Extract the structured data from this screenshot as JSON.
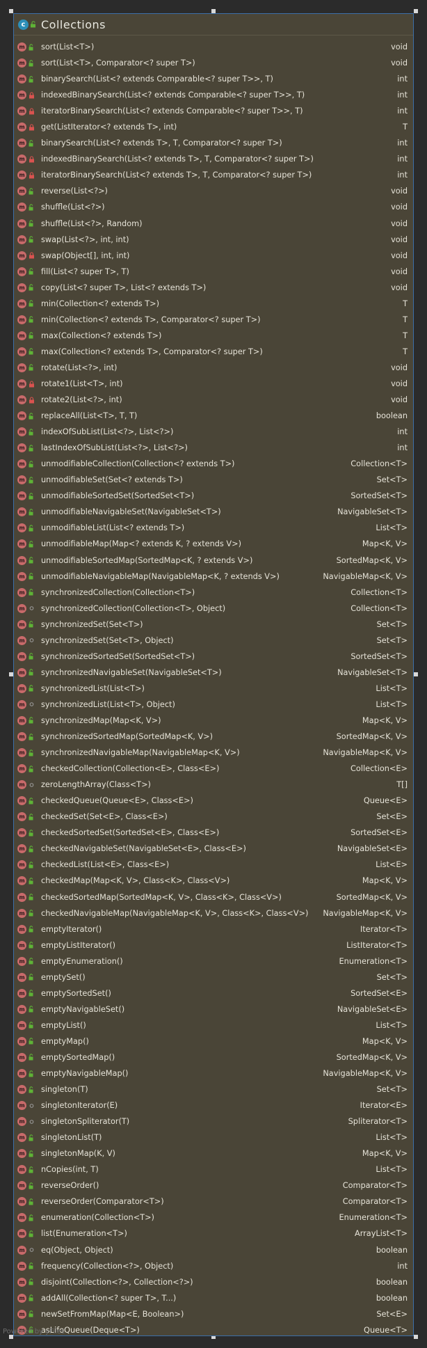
{
  "diagram": {
    "class_name": "Collections",
    "footer": "Powered by yFiles",
    "methods": [
      {
        "signature": "sort(List<T>)",
        "returns": "void",
        "visibility": "public"
      },
      {
        "signature": "sort(List<T>, Comparator<? super T>)",
        "returns": "void",
        "visibility": "public"
      },
      {
        "signature": "binarySearch(List<? extends Comparable<? super T>>, T)",
        "returns": "int",
        "visibility": "public"
      },
      {
        "signature": "indexedBinarySearch(List<? extends Comparable<? super T>>, T)",
        "returns": "int",
        "visibility": "private"
      },
      {
        "signature": "iteratorBinarySearch(List<? extends Comparable<? super T>>, T)",
        "returns": "int",
        "visibility": "private"
      },
      {
        "signature": "get(ListIterator<? extends T>, int)",
        "returns": "T",
        "visibility": "private"
      },
      {
        "signature": "binarySearch(List<? extends T>, T, Comparator<? super T>)",
        "returns": "int",
        "visibility": "public"
      },
      {
        "signature": "indexedBinarySearch(List<? extends T>, T, Comparator<? super T>)",
        "returns": "int",
        "visibility": "private"
      },
      {
        "signature": "iteratorBinarySearch(List<? extends T>, T, Comparator<? super T>)",
        "returns": "int",
        "visibility": "private"
      },
      {
        "signature": "reverse(List<?>)",
        "returns": "void",
        "visibility": "public"
      },
      {
        "signature": "shuffle(List<?>)",
        "returns": "void",
        "visibility": "public"
      },
      {
        "signature": "shuffle(List<?>, Random)",
        "returns": "void",
        "visibility": "public"
      },
      {
        "signature": "swap(List<?>, int, int)",
        "returns": "void",
        "visibility": "public"
      },
      {
        "signature": "swap(Object[], int, int)",
        "returns": "void",
        "visibility": "private"
      },
      {
        "signature": "fill(List<? super T>, T)",
        "returns": "void",
        "visibility": "public"
      },
      {
        "signature": "copy(List<? super T>, List<? extends T>)",
        "returns": "void",
        "visibility": "public"
      },
      {
        "signature": "min(Collection<? extends T>)",
        "returns": "T",
        "visibility": "public"
      },
      {
        "signature": "min(Collection<? extends T>, Comparator<? super T>)",
        "returns": "T",
        "visibility": "public"
      },
      {
        "signature": "max(Collection<? extends T>)",
        "returns": "T",
        "visibility": "public"
      },
      {
        "signature": "max(Collection<? extends T>, Comparator<? super T>)",
        "returns": "T",
        "visibility": "public"
      },
      {
        "signature": "rotate(List<?>, int)",
        "returns": "void",
        "visibility": "public"
      },
      {
        "signature": "rotate1(List<T>, int)",
        "returns": "void",
        "visibility": "private"
      },
      {
        "signature": "rotate2(List<?>, int)",
        "returns": "void",
        "visibility": "private"
      },
      {
        "signature": "replaceAll(List<T>, T, T)",
        "returns": "boolean",
        "visibility": "public"
      },
      {
        "signature": "indexOfSubList(List<?>, List<?>)",
        "returns": "int",
        "visibility": "public"
      },
      {
        "signature": "lastIndexOfSubList(List<?>, List<?>)",
        "returns": "int",
        "visibility": "public"
      },
      {
        "signature": "unmodifiableCollection(Collection<? extends T>)",
        "returns": "Collection<T>",
        "visibility": "public"
      },
      {
        "signature": "unmodifiableSet(Set<? extends T>)",
        "returns": "Set<T>",
        "visibility": "public"
      },
      {
        "signature": "unmodifiableSortedSet(SortedSet<T>)",
        "returns": "SortedSet<T>",
        "visibility": "public"
      },
      {
        "signature": "unmodifiableNavigableSet(NavigableSet<T>)",
        "returns": "NavigableSet<T>",
        "visibility": "public"
      },
      {
        "signature": "unmodifiableList(List<? extends T>)",
        "returns": "List<T>",
        "visibility": "public"
      },
      {
        "signature": "unmodifiableMap(Map<? extends K, ? extends V>)",
        "returns": "Map<K, V>",
        "visibility": "public"
      },
      {
        "signature": "unmodifiableSortedMap(SortedMap<K, ? extends V>)",
        "returns": "SortedMap<K, V>",
        "visibility": "public"
      },
      {
        "signature": "unmodifiableNavigableMap(NavigableMap<K, ? extends V>)",
        "returns": "NavigableMap<K, V>",
        "visibility": "public"
      },
      {
        "signature": "synchronizedCollection(Collection<T>)",
        "returns": "Collection<T>",
        "visibility": "public"
      },
      {
        "signature": "synchronizedCollection(Collection<T>, Object)",
        "returns": "Collection<T>",
        "visibility": "package"
      },
      {
        "signature": "synchronizedSet(Set<T>)",
        "returns": "Set<T>",
        "visibility": "public"
      },
      {
        "signature": "synchronizedSet(Set<T>, Object)",
        "returns": "Set<T>",
        "visibility": "package"
      },
      {
        "signature": "synchronizedSortedSet(SortedSet<T>)",
        "returns": "SortedSet<T>",
        "visibility": "public"
      },
      {
        "signature": "synchronizedNavigableSet(NavigableSet<T>)",
        "returns": "NavigableSet<T>",
        "visibility": "public"
      },
      {
        "signature": "synchronizedList(List<T>)",
        "returns": "List<T>",
        "visibility": "public"
      },
      {
        "signature": "synchronizedList(List<T>, Object)",
        "returns": "List<T>",
        "visibility": "package"
      },
      {
        "signature": "synchronizedMap(Map<K, V>)",
        "returns": "Map<K, V>",
        "visibility": "public"
      },
      {
        "signature": "synchronizedSortedMap(SortedMap<K, V>)",
        "returns": "SortedMap<K, V>",
        "visibility": "public"
      },
      {
        "signature": "synchronizedNavigableMap(NavigableMap<K, V>)",
        "returns": "NavigableMap<K, V>",
        "visibility": "public"
      },
      {
        "signature": "checkedCollection(Collection<E>, Class<E>)",
        "returns": "Collection<E>",
        "visibility": "public"
      },
      {
        "signature": "zeroLengthArray(Class<T>)",
        "returns": "T[]",
        "visibility": "package"
      },
      {
        "signature": "checkedQueue(Queue<E>, Class<E>)",
        "returns": "Queue<E>",
        "visibility": "public"
      },
      {
        "signature": "checkedSet(Set<E>, Class<E>)",
        "returns": "Set<E>",
        "visibility": "public"
      },
      {
        "signature": "checkedSortedSet(SortedSet<E>, Class<E>)",
        "returns": "SortedSet<E>",
        "visibility": "public"
      },
      {
        "signature": "checkedNavigableSet(NavigableSet<E>, Class<E>)",
        "returns": "NavigableSet<E>",
        "visibility": "public"
      },
      {
        "signature": "checkedList(List<E>, Class<E>)",
        "returns": "List<E>",
        "visibility": "public"
      },
      {
        "signature": "checkedMap(Map<K, V>, Class<K>, Class<V>)",
        "returns": "Map<K, V>",
        "visibility": "public"
      },
      {
        "signature": "checkedSortedMap(SortedMap<K, V>, Class<K>, Class<V>)",
        "returns": "SortedMap<K, V>",
        "visibility": "public"
      },
      {
        "signature": "checkedNavigableMap(NavigableMap<K, V>, Class<K>, Class<V>)",
        "returns": "NavigableMap<K, V>",
        "visibility": "public"
      },
      {
        "signature": "emptyIterator()",
        "returns": "Iterator<T>",
        "visibility": "public"
      },
      {
        "signature": "emptyListIterator()",
        "returns": "ListIterator<T>",
        "visibility": "public"
      },
      {
        "signature": "emptyEnumeration()",
        "returns": "Enumeration<T>",
        "visibility": "public"
      },
      {
        "signature": "emptySet()",
        "returns": "Set<T>",
        "visibility": "public"
      },
      {
        "signature": "emptySortedSet()",
        "returns": "SortedSet<E>",
        "visibility": "public"
      },
      {
        "signature": "emptyNavigableSet()",
        "returns": "NavigableSet<E>",
        "visibility": "public"
      },
      {
        "signature": "emptyList()",
        "returns": "List<T>",
        "visibility": "public"
      },
      {
        "signature": "emptyMap()",
        "returns": "Map<K, V>",
        "visibility": "public"
      },
      {
        "signature": "emptySortedMap()",
        "returns": "SortedMap<K, V>",
        "visibility": "public"
      },
      {
        "signature": "emptyNavigableMap()",
        "returns": "NavigableMap<K, V>",
        "visibility": "public"
      },
      {
        "signature": "singleton(T)",
        "returns": "Set<T>",
        "visibility": "public"
      },
      {
        "signature": "singletonIterator(E)",
        "returns": "Iterator<E>",
        "visibility": "package"
      },
      {
        "signature": "singletonSpliterator(T)",
        "returns": "Spliterator<T>",
        "visibility": "package"
      },
      {
        "signature": "singletonList(T)",
        "returns": "List<T>",
        "visibility": "public"
      },
      {
        "signature": "singletonMap(K, V)",
        "returns": "Map<K, V>",
        "visibility": "public"
      },
      {
        "signature": "nCopies(int, T)",
        "returns": "List<T>",
        "visibility": "public"
      },
      {
        "signature": "reverseOrder()",
        "returns": "Comparator<T>",
        "visibility": "public"
      },
      {
        "signature": "reverseOrder(Comparator<T>)",
        "returns": "Comparator<T>",
        "visibility": "public"
      },
      {
        "signature": "enumeration(Collection<T>)",
        "returns": "Enumeration<T>",
        "visibility": "public"
      },
      {
        "signature": "list(Enumeration<T>)",
        "returns": "ArrayList<T>",
        "visibility": "public"
      },
      {
        "signature": "eq(Object, Object)",
        "returns": "boolean",
        "visibility": "package"
      },
      {
        "signature": "frequency(Collection<?>, Object)",
        "returns": "int",
        "visibility": "public"
      },
      {
        "signature": "disjoint(Collection<?>, Collection<?>)",
        "returns": "boolean",
        "visibility": "public"
      },
      {
        "signature": "addAll(Collection<? super T>, T...)",
        "returns": "boolean",
        "visibility": "public"
      },
      {
        "signature": "newSetFromMap(Map<E, Boolean>)",
        "returns": "Set<E>",
        "visibility": "public"
      },
      {
        "signature": "asLifoQueue(Deque<T>)",
        "returns": "Queue<T>",
        "visibility": "public"
      }
    ]
  },
  "colors": {
    "background": "#2b2b2b",
    "card": "#4a4537",
    "card_border": "#3c6fa8",
    "text": "#e6e3d8",
    "method_icon": "#c86a6a",
    "class_icon": "#2d8fb8",
    "public_marker": "#5fb336",
    "private_marker": "#d9534f",
    "package_marker": "#9e9e9e"
  }
}
